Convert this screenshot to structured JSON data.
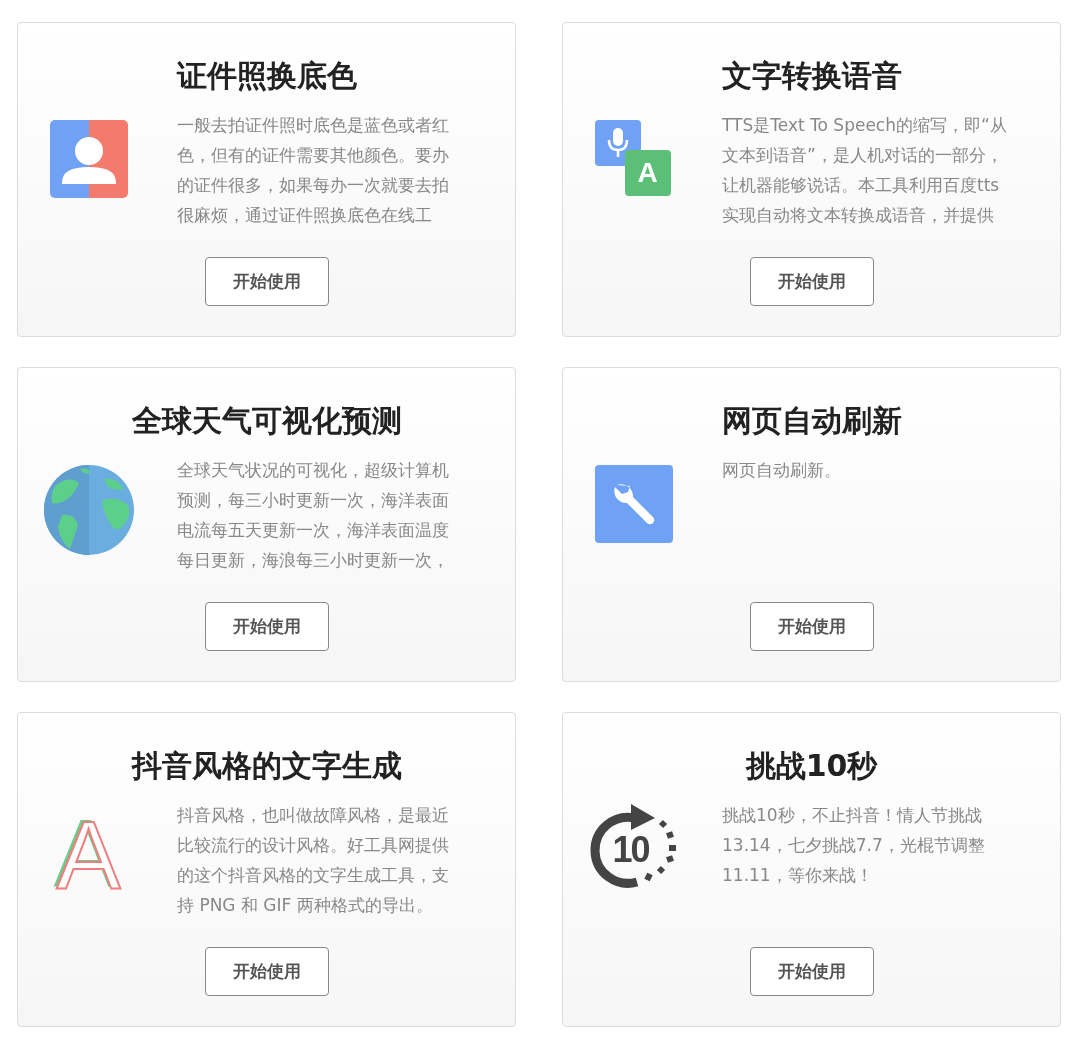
{
  "cards": [
    {
      "title": "证件照换底色",
      "description_lines": [
        "一般去拍证件照时底色是蓝色或者红",
        "色，但有的证件需要其他颜色。要办",
        "的证件很多，如果每办一次就要去拍",
        "很麻烦，通过证件照换底色在线工"
      ],
      "button": "开始使用"
    },
    {
      "title": "文字转换语音",
      "icon_text": "A",
      "description_lines": [
        "TTS是Text To Speech的缩写，即“从",
        "文本到语音”，是人机对话的一部分，",
        "让机器能够说话。本工具利用百度tts",
        "实现自动将文本转换成语音，并提供"
      ],
      "button": "开始使用"
    },
    {
      "title": "全球天气可视化预测",
      "description_lines": [
        "全球天气状况的可视化，超级计算机",
        "预测，每三小时更新一次，海洋表面",
        "电流每五天更新一次，海洋表面温度",
        "每日更新，海浪每三小时更新一次，"
      ],
      "button": "开始使用"
    },
    {
      "title": "网页自动刷新",
      "description_lines": [
        "网页自动刷新。"
      ],
      "button": "开始使用"
    },
    {
      "title": "抖音风格的文字生成",
      "icon_text": "A",
      "description_lines": [
        "抖音风格，也叫做故障风格，是最近",
        "比较流行的设计风格。好工具网提供",
        "的这个抖音风格的文字生成工具，支",
        "持 PNG 和 GIF 两种格式的导出。"
      ],
      "button": "开始使用"
    },
    {
      "title": "挑战10秒",
      "icon_text": "10",
      "description_lines": [
        "挑战10秒，不止抖音！情人节挑战",
        "13.14，七夕挑战7.7，光棍节调整",
        "11.11，等你来战！"
      ],
      "button": "开始使用"
    }
  ]
}
